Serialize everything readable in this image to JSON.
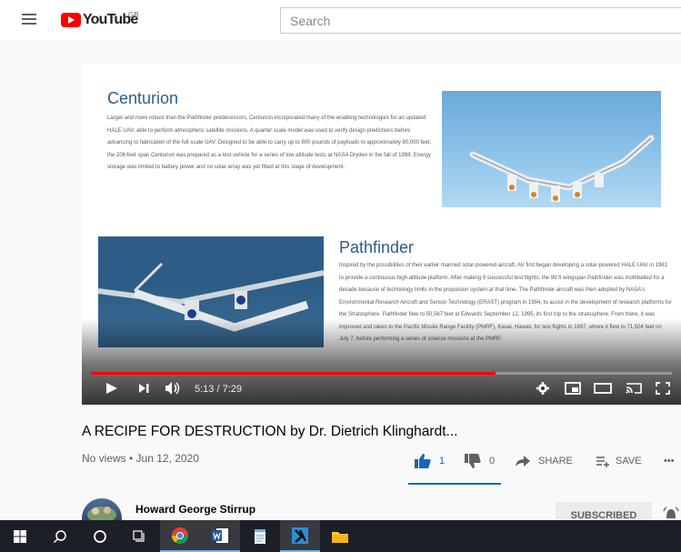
{
  "header": {
    "logo_text": "YouTube",
    "country_code": "GB",
    "search_placeholder": "Search"
  },
  "slide": {
    "centurion": {
      "title": "Centurion",
      "body": "Larger and more robust than the Pathfinder predecessors, Centurion incorporated many of the enabling technologies for an updated HALE UAV, able to perform atmospheric satellite missions. A quarter scale model was used to verify design predictions before advancing to fabrication of the full-scale UAV. Designed to be able to carry up to 600 pounds of payloads to approximately 80,000 feet, the 206 feet span Centurion was prepared as a test vehicle for a series of low altitude tests at NASA Dryden in the fall of 1998. Energy storage was limited to battery power and no solar array was yet fitted at this stage of development."
    },
    "pathfinder": {
      "title": "Pathfinder",
      "body": "Inspired by the possibilities of their earlier manned solar-powered aircraft, AV first began developing a solar-powered HALE UAV in 1981 to provide a continuous high altitude platform. After making 9 successful test flights, the 99 ft wingspan Pathfinder was mothballed for a decade because of technology limits in the propulsion system at that time. The Pathfinder aircraft was then adopted by NASA's Environmental Research Aircraft and Sensor Technology (ERAST) program in 1994, to assist in the development of research platforms for the Stratosphere. Pathfinder flew to 50,567 feet at Edwards September 12, 1995, its first trip to the stratosphere. From there, it was improved and taken to the Pacific Missile Range Facility (PMRF), Kauai, Hawaii, for test flights in 1997, where it flew to 71,504 feet on July 7, before performing a series of science missions at the PMRF."
    }
  },
  "player": {
    "current_time": "5:13",
    "duration": "7:29",
    "time_display": "5:13 / 7:29",
    "progress_fraction": 0.697
  },
  "video": {
    "title": "A RECIPE FOR DESTRUCTION by Dr. Dietrich Klinghardt...",
    "meta": "No views • Jun 12, 2020",
    "likes": "1",
    "dislikes": "0",
    "share_label": "SHARE",
    "save_label": "SAVE",
    "more_label": "•••"
  },
  "channel": {
    "name": "Howard George Stirrup",
    "subscribe_label": "SUBSCRIBED"
  },
  "colors": {
    "brand_red": "#ff0000",
    "like_blue": "#1565c0",
    "taskbar": "#1d1f26"
  },
  "taskbar": {
    "icons": [
      "windows-start-icon",
      "search-icon",
      "cortana-icon",
      "task-view-icon",
      "chrome-icon",
      "word-icon",
      "notepad-icon",
      "app-icon",
      "file-explorer-icon"
    ]
  }
}
